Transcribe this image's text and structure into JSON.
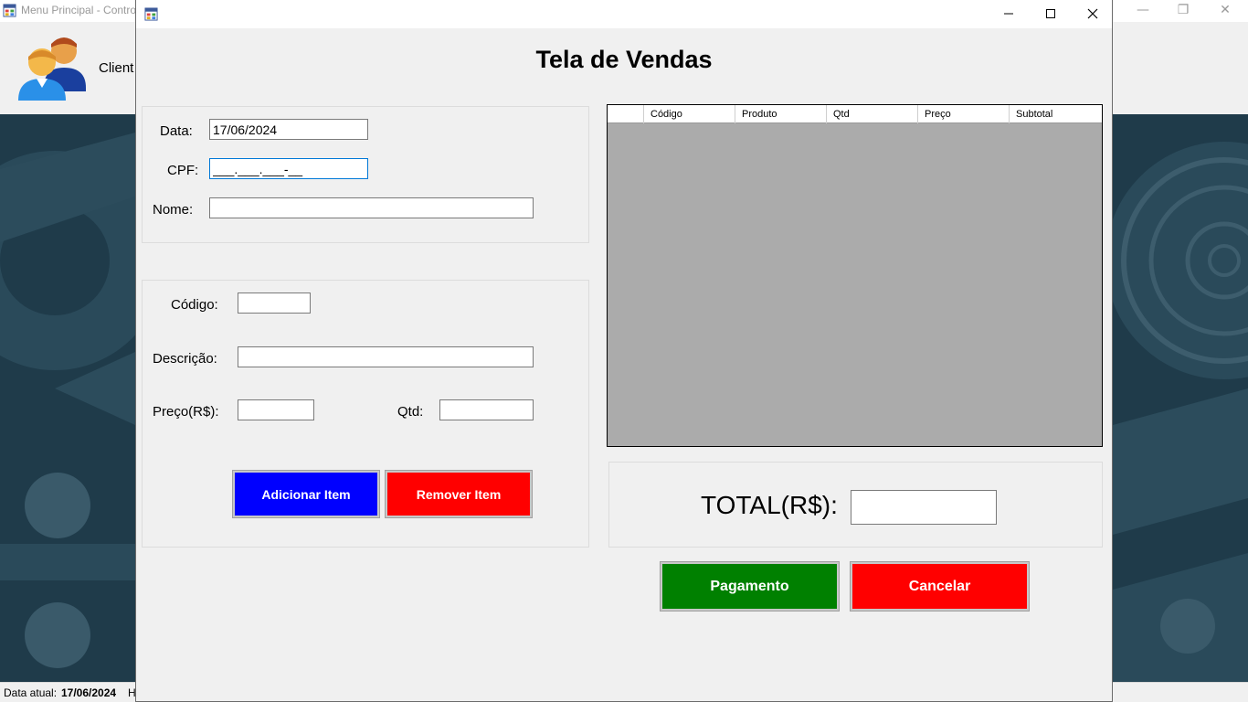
{
  "background": {
    "window_title": "Menu Principal - Contro",
    "menu_item_label": "Client",
    "status_label": "Data atual:",
    "status_value": "17/06/2024",
    "status_next": "H"
  },
  "dialog": {
    "heading": "Tela de Vendas",
    "cliente": {
      "data_label": "Data:",
      "data_value": "17/06/2024",
      "cpf_label": "CPF:",
      "cpf_value": "___.___.___-__",
      "nome_label": "Nome:",
      "nome_value": ""
    },
    "produto": {
      "codigo_label": "Código:",
      "codigo_value": "",
      "descricao_label": "Descrição:",
      "descricao_value": "",
      "preco_label": "Preço(R$):",
      "preco_value": "",
      "qtd_label": "Qtd:",
      "qtd_value": "",
      "add_button": "Adicionar Item",
      "remove_button": "Remover Item"
    },
    "grid": {
      "columns": [
        "",
        "Código",
        "Produto",
        "Qtd",
        "Preço",
        "Subtotal"
      ],
      "rows": []
    },
    "total": {
      "label": "TOTAL(R$):",
      "value": ""
    },
    "payment_button": "Pagamento",
    "cancel_button": "Cancelar"
  },
  "colors": {
    "add_button": "#0000ff",
    "remove_button": "#ff0000",
    "payment_button": "#008000",
    "cancel_button": "#ff0000",
    "grid_background": "#ababab"
  }
}
